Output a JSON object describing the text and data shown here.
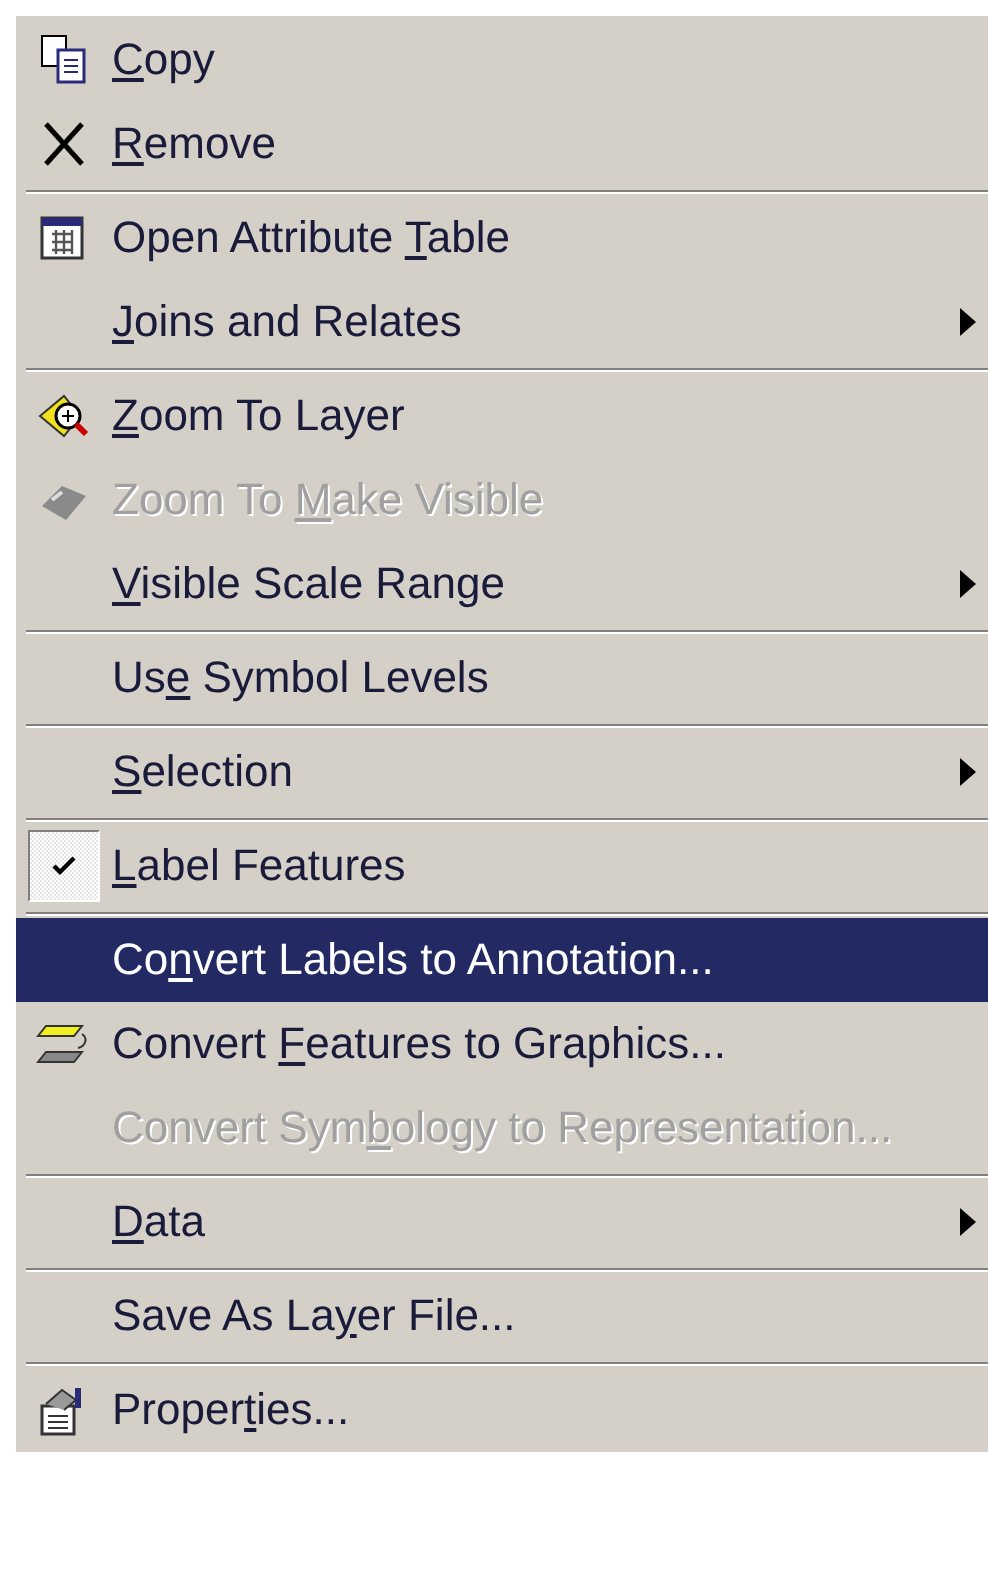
{
  "menu": {
    "items": [
      {
        "kind": "item",
        "key": "C",
        "after": "opy",
        "disabled": false,
        "selected": false,
        "checked": false,
        "submenu": false
      },
      {
        "kind": "item",
        "key": "R",
        "after": "emove",
        "disabled": false,
        "selected": false,
        "checked": false,
        "submenu": false
      },
      {
        "kind": "separator"
      },
      {
        "kind": "item",
        "before": "Open Attribute ",
        "key": "T",
        "after": "able",
        "disabled": false,
        "selected": false,
        "checked": false,
        "submenu": false
      },
      {
        "kind": "item",
        "key": "J",
        "after": "oins and Relates",
        "disabled": false,
        "selected": false,
        "checked": false,
        "submenu": true
      },
      {
        "kind": "separator"
      },
      {
        "kind": "item",
        "key": "Z",
        "after": "oom To Layer",
        "disabled": false,
        "selected": false,
        "checked": false,
        "submenu": false
      },
      {
        "kind": "item",
        "before": "Zoom To ",
        "key": "M",
        "after": "ake Visible",
        "disabled": true,
        "selected": false,
        "checked": false,
        "submenu": false
      },
      {
        "kind": "item",
        "key": "V",
        "after": "isible Scale Range",
        "disabled": false,
        "selected": false,
        "checked": false,
        "submenu": true
      },
      {
        "kind": "separator"
      },
      {
        "kind": "item",
        "before": "Us",
        "key": "e",
        "after": " Symbol Levels",
        "disabled": false,
        "selected": false,
        "checked": false,
        "submenu": false
      },
      {
        "kind": "separator"
      },
      {
        "kind": "item",
        "key": "S",
        "after": "election",
        "disabled": false,
        "selected": false,
        "checked": false,
        "submenu": true
      },
      {
        "kind": "separator"
      },
      {
        "kind": "item",
        "key": "L",
        "after": "abel Features",
        "disabled": false,
        "selected": false,
        "checked": true,
        "submenu": false
      },
      {
        "kind": "separator"
      },
      {
        "kind": "item",
        "before": "Co",
        "key": "n",
        "after": "vert Labels to Annotation...",
        "disabled": false,
        "selected": true,
        "checked": false,
        "submenu": false
      },
      {
        "kind": "item",
        "before": "Convert ",
        "key": "F",
        "after": "eatures to Graphics...",
        "disabled": false,
        "selected": false,
        "checked": false,
        "submenu": false
      },
      {
        "kind": "item",
        "before": "Convert Sym",
        "key": "b",
        "after": "ology to Representation...",
        "disabled": true,
        "selected": false,
        "checked": false,
        "submenu": false
      },
      {
        "kind": "separator"
      },
      {
        "kind": "item",
        "key": "D",
        "after": "ata",
        "disabled": false,
        "selected": false,
        "checked": false,
        "submenu": true
      },
      {
        "kind": "separator"
      },
      {
        "kind": "item",
        "before": "Save As La",
        "key": "y",
        "after": "er File...",
        "disabled": false,
        "selected": false,
        "checked": false,
        "submenu": false
      },
      {
        "kind": "separator"
      },
      {
        "kind": "item",
        "before": "Proper",
        "key": "t",
        "after": "ies...",
        "disabled": false,
        "selected": false,
        "checked": false,
        "submenu": false
      }
    ]
  }
}
